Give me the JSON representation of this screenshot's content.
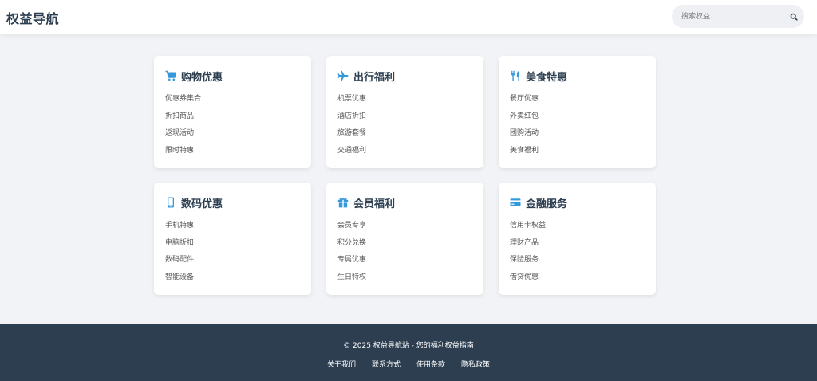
{
  "header": {
    "brand": "权益导航",
    "search": {
      "placeholder": "搜索权益...",
      "icon": "search-icon"
    }
  },
  "colors": {
    "accent": "#3498db",
    "header_bg": "#ffffff",
    "page_bg": "#f1f3f6",
    "footer_bg": "#2c3e50",
    "title_text": "#2c3e50",
    "link_text": "#555555"
  },
  "categories": [
    {
      "icon": "shopping-cart-icon",
      "title": "购物优惠",
      "links": [
        "优惠券集合",
        "折扣商品",
        "返现活动",
        "限时特惠"
      ]
    },
    {
      "icon": "airplane-icon",
      "title": "出行福利",
      "links": [
        "机票优惠",
        "酒店折扣",
        "旅游套餐",
        "交通福利"
      ]
    },
    {
      "icon": "utensils-icon",
      "title": "美食特惠",
      "links": [
        "餐厅优惠",
        "外卖红包",
        "团购活动",
        "美食福利"
      ]
    },
    {
      "icon": "mobile-phone-icon",
      "title": "数码优惠",
      "links": [
        "手机特惠",
        "电脑折扣",
        "数码配件",
        "智能设备"
      ]
    },
    {
      "icon": "gift-icon",
      "title": "会员福利",
      "links": [
        "会员专享",
        "积分兑换",
        "专属优惠",
        "生日特权"
      ]
    },
    {
      "icon": "credit-card-icon",
      "title": "金融服务",
      "links": [
        "信用卡权益",
        "理财产品",
        "保险服务",
        "借贷优惠"
      ]
    }
  ],
  "footer": {
    "copyright": "© 2025 权益导航站 - 您的福利权益指南",
    "links": [
      "关于我们",
      "联系方式",
      "使用条款",
      "隐私政策"
    ]
  }
}
